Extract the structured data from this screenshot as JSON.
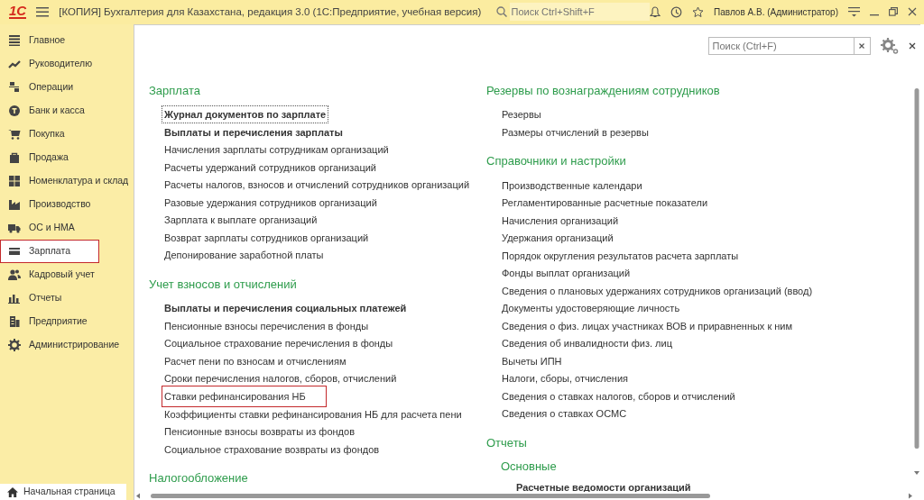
{
  "window": {
    "logo": "1С",
    "title": "[КОПИЯ] Бухгалтерия для Казахстана, редакция 3.0  (1С:Предприятие, учебная версия)",
    "search": {
      "placeholder": "Поиск Ctrl+Shift+F"
    },
    "user": "Павлов А.В. (Администратор)"
  },
  "sidebar": {
    "items": [
      {
        "label": "Главное",
        "selected": false
      },
      {
        "label": "Руководителю",
        "selected": false
      },
      {
        "label": "Операции",
        "selected": false
      },
      {
        "label": "Банк и касса",
        "selected": false
      },
      {
        "label": "Покупка",
        "selected": false
      },
      {
        "label": "Продажа",
        "selected": false
      },
      {
        "label": "Номенклатура и склад",
        "selected": false
      },
      {
        "label": "Производство",
        "selected": false
      },
      {
        "label": "ОС и НМА",
        "selected": false
      },
      {
        "label": "Зарплата",
        "selected": true
      },
      {
        "label": "Кадровый учет",
        "selected": false
      },
      {
        "label": "Отчеты",
        "selected": false
      },
      {
        "label": "Предприятие",
        "selected": false
      },
      {
        "label": "Администрирование",
        "selected": false
      }
    ]
  },
  "home_tab": {
    "label": "Начальная страница"
  },
  "panel": {
    "search": {
      "placeholder": "Поиск (Ctrl+F)"
    },
    "columns": [
      {
        "sections": [
          {
            "title": "Зарплата",
            "items": [
              {
                "label": "Журнал документов по зарплате",
                "bold": true,
                "focused": true,
                "highlighted": false
              },
              {
                "label": "Выплаты и перечисления зарплаты",
                "bold": true,
                "focused": false,
                "highlighted": false
              },
              {
                "label": "Начисления зарплаты сотрудникам организаций",
                "bold": false,
                "focused": false,
                "highlighted": false
              },
              {
                "label": "Расчеты удержаний сотрудников организаций",
                "bold": false,
                "focused": false,
                "highlighted": false
              },
              {
                "label": "Расчеты налогов, взносов и отчислений сотрудников организаций",
                "bold": false,
                "focused": false,
                "highlighted": false
              },
              {
                "label": "Разовые удержания сотрудников организаций",
                "bold": false,
                "focused": false,
                "highlighted": false
              },
              {
                "label": "Зарплата к выплате организаций",
                "bold": false,
                "focused": false,
                "highlighted": false
              },
              {
                "label": "Возврат зарплаты сотрудников организаций",
                "bold": false,
                "focused": false,
                "highlighted": false
              },
              {
                "label": "Депонирование заработной платы",
                "bold": false,
                "focused": false,
                "highlighted": false
              }
            ]
          },
          {
            "title": "Учет взносов и отчислений",
            "items": [
              {
                "label": "Выплаты и перечисления социальных платежей",
                "bold": true,
                "focused": false,
                "highlighted": false
              },
              {
                "label": "Пенсионные взносы перечисления в фонды",
                "bold": false,
                "focused": false,
                "highlighted": false
              },
              {
                "label": "Социальное страхование перечисления в фонды",
                "bold": false,
                "focused": false,
                "highlighted": false
              },
              {
                "label": "Расчет пени по взносам и отчислениям",
                "bold": false,
                "focused": false,
                "highlighted": false
              },
              {
                "label": "Сроки перечисления налогов, сборов, отчислений",
                "bold": false,
                "focused": false,
                "highlighted": false
              },
              {
                "label": "Ставки рефинансирования НБ",
                "bold": false,
                "focused": false,
                "highlighted": true
              },
              {
                "label": "Коэффициенты ставки рефинансирования НБ для расчета пени",
                "bold": false,
                "focused": false,
                "highlighted": false
              },
              {
                "label": "Пенсионные взносы возвраты из фондов",
                "bold": false,
                "focused": false,
                "highlighted": false
              },
              {
                "label": "Социальное страхование возвраты из фондов",
                "bold": false,
                "focused": false,
                "highlighted": false
              }
            ]
          },
          {
            "title": "Налогообложение"
          }
        ]
      },
      {
        "sections": [
          {
            "title": "Резервы по вознаграждениям сотрудников",
            "items": [
              {
                "label": "Резервы",
                "bold": false,
                "focused": false,
                "highlighted": false
              },
              {
                "label": "Размеры отчислений в резервы",
                "bold": false,
                "focused": false,
                "highlighted": false
              }
            ]
          },
          {
            "title": "Справочники и настройки",
            "items": [
              {
                "label": "Производственные календари",
                "bold": false,
                "focused": false,
                "highlighted": false
              },
              {
                "label": "Регламентированные расчетные показатели",
                "bold": false,
                "focused": false,
                "highlighted": false
              },
              {
                "label": "Начисления организаций",
                "bold": false,
                "focused": false,
                "highlighted": false
              },
              {
                "label": "Удержания организаций",
                "bold": false,
                "focused": false,
                "highlighted": false
              },
              {
                "label": "Порядок округления результатов расчета зарплаты",
                "bold": false,
                "focused": false,
                "highlighted": false
              },
              {
                "label": "Фонды выплат организаций",
                "bold": false,
                "focused": false,
                "highlighted": false
              },
              {
                "label": "Сведения о плановых удержаниях сотрудников организаций (ввод)",
                "bold": false,
                "focused": false,
                "highlighted": false
              },
              {
                "label": "Документы удостоверяющие личность",
                "bold": false,
                "focused": false,
                "highlighted": false
              },
              {
                "label": "Сведения о физ. лицах участниках ВОВ и приравненных к ним",
                "bold": false,
                "focused": false,
                "highlighted": false
              },
              {
                "label": "Сведения об инвалидности физ. лиц",
                "bold": false,
                "focused": false,
                "highlighted": false
              },
              {
                "label": "Вычеты ИПН",
                "bold": false,
                "focused": false,
                "highlighted": false
              },
              {
                "label": "Налоги, сборы, отчисления",
                "bold": false,
                "focused": false,
                "highlighted": false
              },
              {
                "label": "Сведения о ставках налогов, сборов и отчислений",
                "bold": false,
                "focused": false,
                "highlighted": false
              },
              {
                "label": "Сведения о ставках ОСМС",
                "bold": false,
                "focused": false,
                "highlighted": false
              }
            ]
          },
          {
            "title": "Отчеты",
            "subtitle": "Основные",
            "items": [
              {
                "label": "Расчетные ведомости организаций",
                "bold": true,
                "focused": false,
                "highlighted": false
              }
            ]
          }
        ]
      }
    ]
  }
}
